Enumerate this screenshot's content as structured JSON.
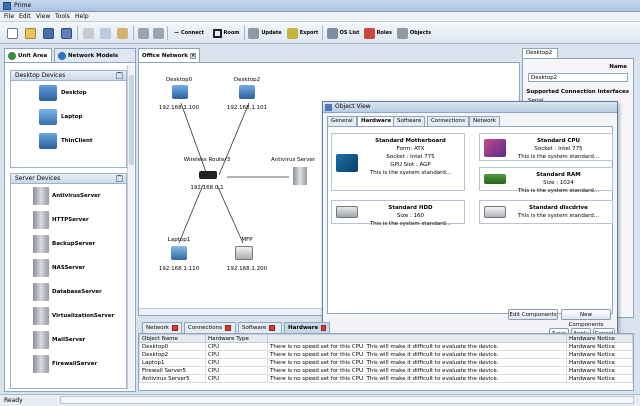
{
  "window": {
    "title": "Prime"
  },
  "menu": [
    "File",
    "Edit",
    "View",
    "Tools",
    "Help"
  ],
  "toolbar": {
    "connect": "Connect",
    "room": "Room",
    "update": "Update",
    "export": "Export",
    "os_list": "OS List",
    "roles": "Roles",
    "objects": "Objects"
  },
  "left_tabs": [
    "Unit Area",
    "Network Models"
  ],
  "desktop_devices": {
    "title": "Desktop Devices",
    "items": [
      "Desktop",
      "Laptop",
      "ThinClient"
    ]
  },
  "server_devices": {
    "title": "Server Devices",
    "items": [
      "AntivirusServer",
      "HTTPServer",
      "BackupServer",
      "NASServer",
      "DatabaseServer",
      "VirtualizationServer",
      "MailServer",
      "FirewallServer"
    ]
  },
  "workspace_tab": "Office Network",
  "nodes": {
    "desktop0": {
      "name": "Desktop0",
      "ip": "192.168.1.100"
    },
    "desktop2": {
      "name": "Desktop2",
      "ip": "192.168.1.101"
    },
    "router": {
      "name": "Wireless Router3",
      "ip": "192.168.0.1"
    },
    "antivirus": {
      "name": "Antivirus Server"
    },
    "laptop": {
      "name": "Laptop1",
      "ip": "192.168.1.110"
    },
    "mfp": {
      "name": "MFP",
      "ip": "192.168.1.200"
    }
  },
  "right_panel": {
    "tab": "Desktop2",
    "name_label": "Name",
    "name_value": "Desktop2",
    "interfaces_label": "Supported Connection Interfaces",
    "interface_partial": "Serial"
  },
  "object_view": {
    "title": "Object View",
    "tabs": [
      "General",
      "Hardware",
      "Software",
      "Connections",
      "Network"
    ],
    "active_tab": "Hardware",
    "cards": [
      {
        "lines": [
          "Standard Motherboard",
          "Form: ATX",
          "Socket : Intel 775",
          "GPU Slot : AGP",
          "This is the system standard..."
        ]
      },
      {
        "lines": [
          "Standard CPU",
          "Socket : Intel 775",
          "This is the system standard..."
        ]
      },
      {
        "lines": [
          "Standard RAM",
          "Size : 1024",
          "This is the system standard..."
        ]
      },
      {
        "lines": [
          "Standard HDD",
          "Size : 160",
          "This is the system standard..."
        ]
      },
      {
        "lines": [
          "Standard discdrive",
          "This is the system standard..."
        ]
      }
    ],
    "edit_components": "Edit Components",
    "new_components": "New Components",
    "save": "Save",
    "apply": "Apply",
    "cancel": "Cancel"
  },
  "bottom_tabs": [
    "Network",
    "Connections",
    "Software",
    "Hardware"
  ],
  "notices": {
    "columns": [
      "Object Name",
      "Hardware Type",
      "",
      "Hardware Notice"
    ],
    "rows": [
      [
        "Desktop0",
        "CPU",
        "There is no speed set for this CPU. This will make it difficult to evaluate the device.",
        "Hardware Notice"
      ],
      [
        "Desktop2",
        "CPU",
        "There is no speed set for this CPU. This will make it difficult to evaluate the device.",
        "Hardware Notice"
      ],
      [
        "Laptop1",
        "CPU",
        "There is no speed set for this CPU. This will make it difficult to evaluate the device.",
        "Hardware Notice"
      ],
      [
        "Firewall Server5",
        "CPU",
        "There is no speed set for this CPU. This will make it difficult to evaluate the device.",
        "Hardware Notice"
      ],
      [
        "Antivirus Server5",
        "CPU",
        "There is no speed set for this CPU. This will make it difficult to evaluate the device.",
        "Hardware Notice"
      ]
    ]
  },
  "status": "Ready"
}
